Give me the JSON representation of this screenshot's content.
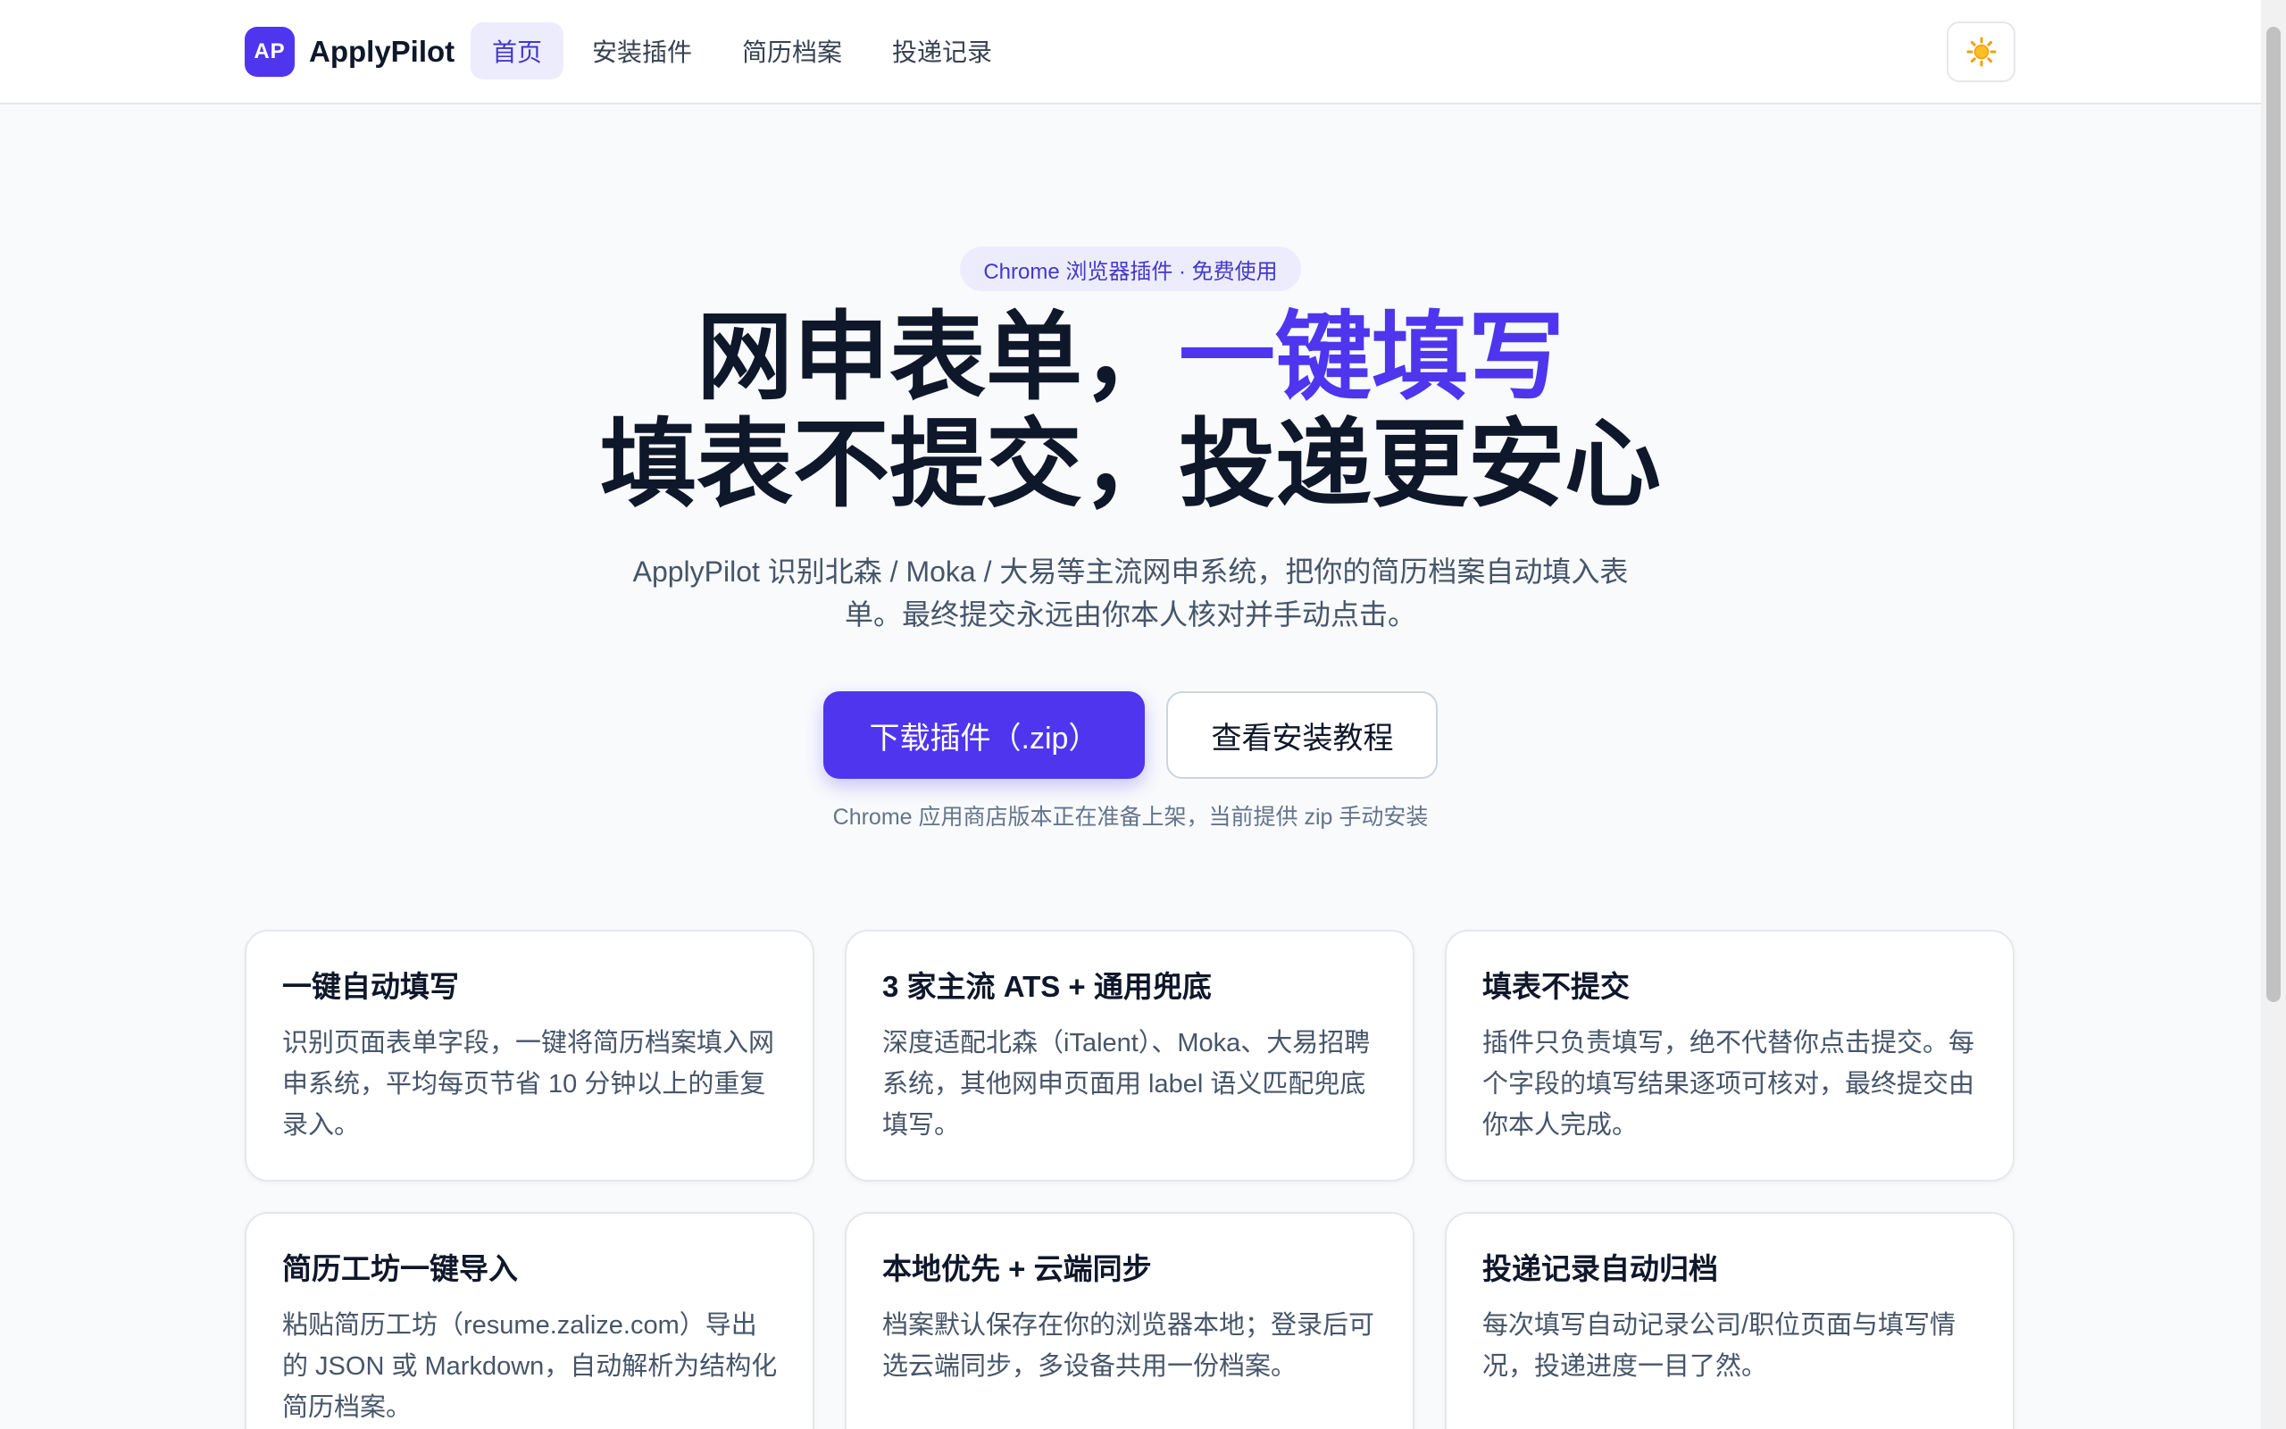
{
  "header": {
    "logo_text": "AP",
    "brand": "ApplyPilot",
    "nav": [
      {
        "label": "首页",
        "active": true
      },
      {
        "label": "安装插件",
        "active": false
      },
      {
        "label": "简历档案",
        "active": false
      },
      {
        "label": "投递记录",
        "active": false
      }
    ],
    "theme_icon": "sun-icon"
  },
  "hero": {
    "badge": "Chrome 浏览器插件 · 免费使用",
    "headline_line1_prefix": "网申表单，",
    "headline_line1_accent": "一键填写",
    "headline_line2": "填表不提交，投递更安心",
    "subtitle": "ApplyPilot 识别北森 / Moka / 大易等主流网申系统，把你的简历档案自动填入表单。最终提交永远由你本人核对并手动点击。",
    "primary_button": "下载插件（.zip）",
    "secondary_button": "查看安装教程",
    "note": "Chrome 应用商店版本正在准备上架，当前提供 zip 手动安装"
  },
  "features": [
    {
      "title": "一键自动填写",
      "desc": "识别页面表单字段，一键将简历档案填入网申系统，平均每页节省 10 分钟以上的重复录入。"
    },
    {
      "title": "3 家主流 ATS + 通用兜底",
      "desc": "深度适配北森（iTalent）、Moka、大易招聘系统，其他网申页面用 label 语义匹配兜底填写。"
    },
    {
      "title": "填表不提交",
      "desc": "插件只负责填写，绝不代替你点击提交。每个字段的填写结果逐项可核对，最终提交由你本人完成。"
    },
    {
      "title": "简历工坊一键导入",
      "desc": "粘贴简历工坊（resume.zalize.com）导出的 JSON 或 Markdown，自动解析为结构化简历档案。"
    },
    {
      "title": "本地优先 + 云端同步",
      "desc": "档案默认保存在你的浏览器本地；登录后可选云端同步，多设备共用一份档案。"
    },
    {
      "title": "投递记录自动归档",
      "desc": "每次填写自动记录公司/职位页面与填写情况，投递进度一目了然。"
    }
  ],
  "colors": {
    "accent": "#4f35ee",
    "background": "#f8fafc",
    "text": "#0f172a",
    "muted": "#475569"
  }
}
